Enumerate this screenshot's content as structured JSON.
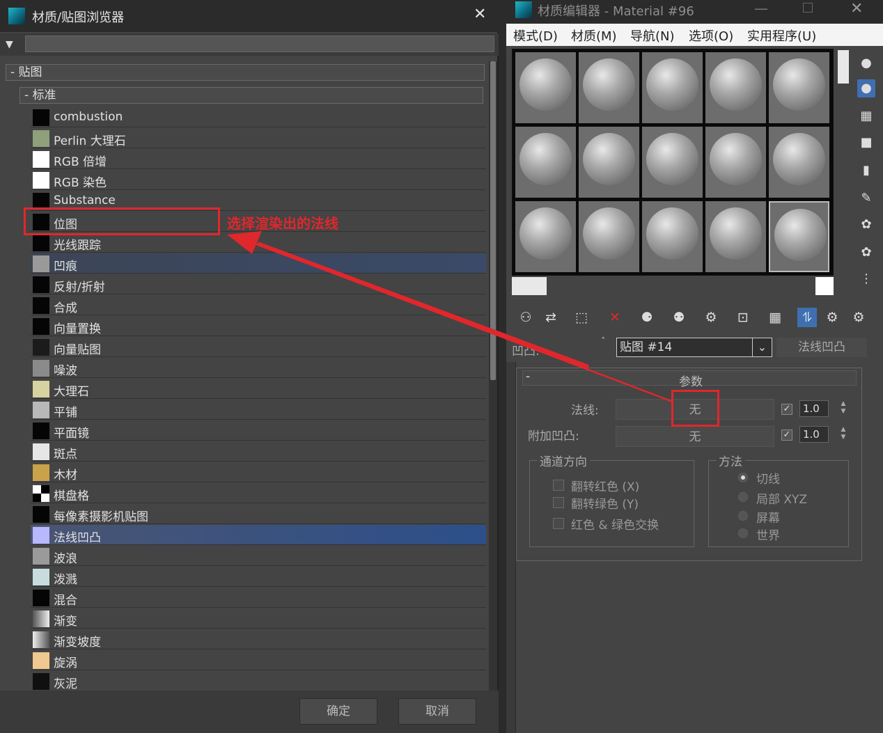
{
  "browser": {
    "title": "材质/贴图浏览器",
    "close": "✕",
    "filter_toggle": "▼",
    "search_value": "",
    "group_maps": "- 贴图",
    "group_standard": "- 标准",
    "items": [
      {
        "label": "combustion",
        "swatch": "#050505"
      },
      {
        "label": "Perlin 大理石",
        "swatch": "#8fa07a"
      },
      {
        "label": "RGB 倍增",
        "swatch": "#ffffff"
      },
      {
        "label": "RGB 染色",
        "swatch": "#ffffff"
      },
      {
        "label": "Substance",
        "swatch": "#050505"
      },
      {
        "label": "位图",
        "swatch": "#050505"
      },
      {
        "label": "光线跟踪",
        "swatch": "#050505"
      },
      {
        "label": "凹痕",
        "swatch": "#9a9a9a"
      },
      {
        "label": "反射/折射",
        "swatch": "#050505"
      },
      {
        "label": "合成",
        "swatch": "#050505"
      },
      {
        "label": "向量置换",
        "swatch": "#050505"
      },
      {
        "label": "向量贴图",
        "swatch": "#1b1b1b"
      },
      {
        "label": "噪波",
        "swatch": "#8a8a8a"
      },
      {
        "label": "大理石",
        "swatch": "#d8d2a0"
      },
      {
        "label": "平铺",
        "swatch": "#b8b8b8"
      },
      {
        "label": "平面镜",
        "swatch": "#050505"
      },
      {
        "label": "斑点",
        "swatch": "#e6e6e6"
      },
      {
        "label": "木材",
        "swatch": "#c9a24a"
      },
      {
        "label": "棋盘格",
        "swatch": "#ffffff"
      },
      {
        "label": "每像素摄影机贴图",
        "swatch": "#050505"
      },
      {
        "label": "法线凹凸",
        "swatch": "#b8b8ff"
      },
      {
        "label": "波浪",
        "swatch": "#9a9a9a"
      },
      {
        "label": "泼溅",
        "swatch": "#c8dce0"
      },
      {
        "label": "混合",
        "swatch": "#050505"
      },
      {
        "label": "渐变",
        "swatch": "#cfcfcf"
      },
      {
        "label": "渐变坡度",
        "swatch": "#b0b0b0"
      },
      {
        "label": "旋涡",
        "swatch": "#f0c890"
      },
      {
        "label": "灰泥",
        "swatch": "#101010"
      }
    ],
    "ok_label": "确定",
    "cancel_label": "取消"
  },
  "annotation": {
    "text": "选择渲染出的法线",
    "color": "#e0272c"
  },
  "editor": {
    "title": "材质编辑器 - Material #96",
    "minimize": "—",
    "close": "✕",
    "menu": [
      "模式(D)",
      "材质(M)",
      "导航(N)",
      "选项(O)",
      "实用程序(U)"
    ],
    "map_label": "凹凸:",
    "map_name": "贴图 #14",
    "map_type": "法线凹凸",
    "params_title": "参数",
    "params_collapse": "-",
    "normal_label": "法线:",
    "normal_map": "无",
    "normal_enabled": true,
    "normal_amount": "1.0",
    "extra_bump_label": "附加凹凸:",
    "extra_bump_map": "无",
    "extra_bump_enabled": true,
    "extra_bump_amount": "1.0",
    "channel_group": "通道方向",
    "flip_red": "翻转红色 (X)",
    "flip_green": "翻转绿色 (Y)",
    "swap_rg": "红色 & 绿色交换",
    "method_group": "方法",
    "methods": [
      "切线",
      "局部 XYZ",
      "屏幕",
      "世界"
    ],
    "method_selected": "切线"
  },
  "colors": {
    "accent_red": "#e0272c",
    "selected_row": "#2c4f8a",
    "toolbar_active": "#3f6fb0"
  }
}
